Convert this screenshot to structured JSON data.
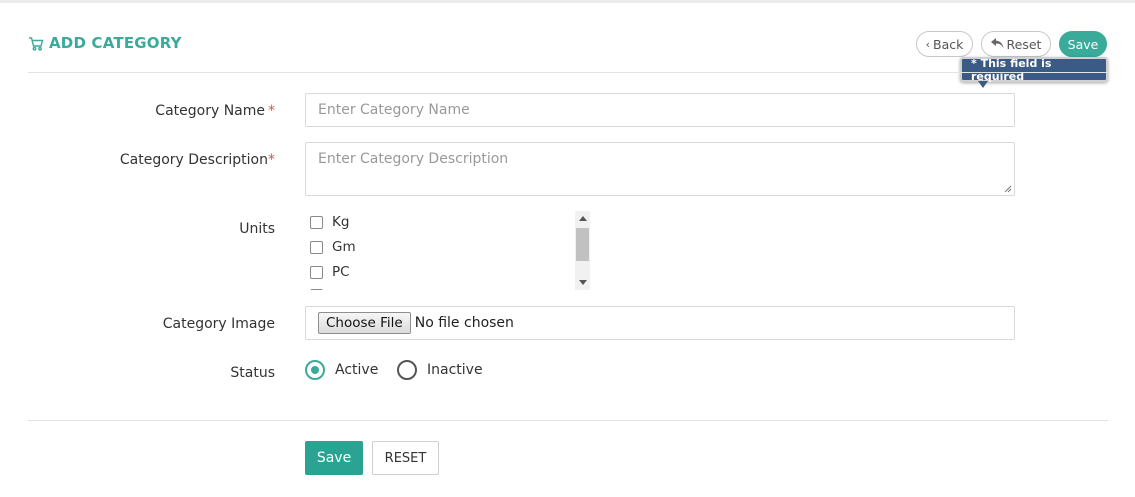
{
  "header": {
    "title": "ADD CATEGORY",
    "title_icon": "cart-icon",
    "back_label": "Back",
    "reset_label": "Reset",
    "save_label": "Save"
  },
  "tooltip": {
    "text": "* This field is required"
  },
  "form": {
    "name": {
      "label": "Category Name",
      "required_mark": "*",
      "placeholder": "Enter Category Name",
      "value": ""
    },
    "description": {
      "label": "Category Description",
      "required_mark": "*",
      "placeholder": "Enter Category Description",
      "value": ""
    },
    "units": {
      "label": "Units",
      "options": [
        {
          "label": "Kg",
          "checked": false
        },
        {
          "label": "Gm",
          "checked": false
        },
        {
          "label": "PC",
          "checked": false
        }
      ]
    },
    "image": {
      "label": "Category Image",
      "button_label": "Choose File",
      "status": "No file chosen"
    },
    "status": {
      "label": "Status",
      "options": [
        {
          "label": "Active",
          "selected": true
        },
        {
          "label": "Inactive",
          "selected": false
        }
      ]
    }
  },
  "footer": {
    "save_label": "Save",
    "reset_label": "RESET"
  },
  "colors": {
    "accent": "#3aaa9a",
    "required": "#d9534f",
    "tooltip_bg": "#3b5a85"
  }
}
